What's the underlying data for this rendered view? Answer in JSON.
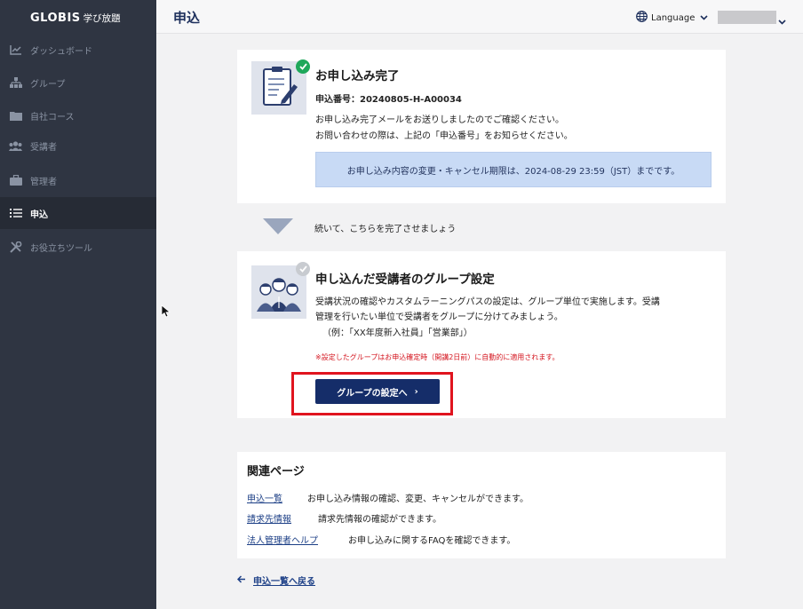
{
  "app": {
    "brand": "GLOBIS",
    "brand_sub": "学び放題"
  },
  "sidebar": {
    "items": [
      {
        "label": "ダッシュボード",
        "icon": "chart-line-icon"
      },
      {
        "label": "グループ",
        "icon": "hierarchy-icon"
      },
      {
        "label": "自社コース",
        "icon": "folder-icon"
      },
      {
        "label": "受講者",
        "icon": "users-icon"
      },
      {
        "label": "管理者",
        "icon": "briefcase-icon"
      },
      {
        "label": "申込",
        "icon": "list-icon",
        "active": true
      },
      {
        "label": "お役立ちツール",
        "icon": "tools-icon"
      }
    ]
  },
  "header": {
    "title": "申込",
    "language_label": "Language"
  },
  "completion": {
    "title": "お申し込み完了",
    "application_number": "申込番号：20240805-H-A00034",
    "line1": "お申し込み完了メールをお送りしましたのでご確認ください。",
    "line2": "お問い合わせの際は、上記の「申込番号」をお知らせください。",
    "notice": "お申し込み内容の変更・キャンセル期限は、2024-08-29 23:59（JST）までです。"
  },
  "next_step": {
    "text": "続いて、こちらを完了させましょう"
  },
  "group_setup": {
    "title": "申し込んだ受講者のグループ設定",
    "line1": "受講状況の確認やカスタムラーニングパスの設定は、グループ単位で実施します。受講",
    "line2": "管理を行いたい単位で受講者をグループに分けてみましょう。",
    "line3": "（例：「XX年度新入社員」「営業部」）",
    "warning": "※設定したグループはお申込確定時（開講2日前）に自動的に適用されます。",
    "button_label": "グループの設定へ",
    "button_chevron": "›"
  },
  "related": {
    "title": "関連ページ",
    "links": [
      {
        "label": "申込一覧",
        "desc": "お申し込み情報の確認、変更、キャンセルができます。"
      },
      {
        "label": "請求先情報",
        "desc": "請求先情報の確認ができます。"
      },
      {
        "label": "法人管理者ヘルプ",
        "desc": "お申し込みに関するFAQを確認できます。"
      }
    ]
  },
  "back_link": {
    "label": "申込一覧へ戻る"
  },
  "colors": {
    "sidebar_bg": "#2f3542",
    "primary": "#152d69",
    "success": "#1fa85b",
    "warning": "#d4141e",
    "notice_bg": "#c8daf5"
  }
}
